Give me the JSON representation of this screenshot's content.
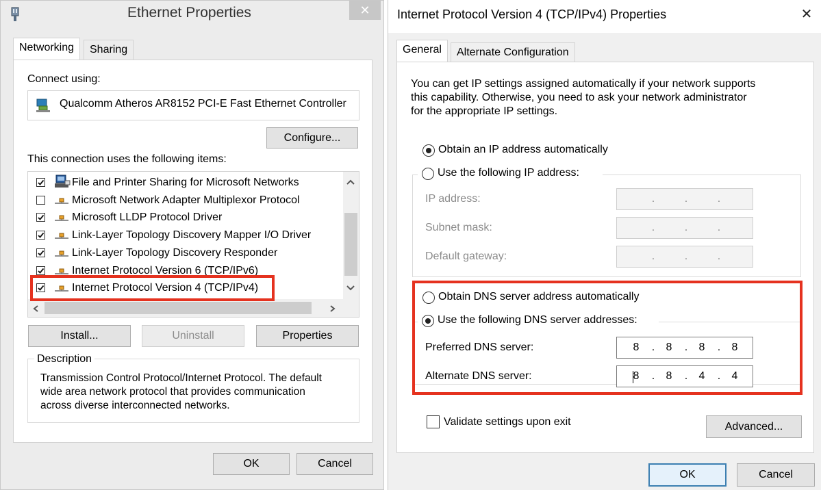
{
  "ethernet": {
    "title": "Ethernet Properties",
    "tabs": [
      "Networking",
      "Sharing"
    ],
    "connect_using_label": "Connect using:",
    "adapter_name": "Qualcomm Atheros AR8152 PCI-E Fast Ethernet Controller",
    "configure_label": "Configure...",
    "items_label": "This connection uses the following items:",
    "items": [
      {
        "label": "File and Printer Sharing for Microsoft Networks",
        "checked": true
      },
      {
        "label": "Microsoft Network Adapter Multiplexor Protocol",
        "checked": false
      },
      {
        "label": "Microsoft LLDP Protocol Driver",
        "checked": true
      },
      {
        "label": "Link-Layer Topology Discovery Mapper I/O Driver",
        "checked": true
      },
      {
        "label": "Link-Layer Topology Discovery Responder",
        "checked": true
      },
      {
        "label": "Internet Protocol Version 6 (TCP/IPv6)",
        "checked": true
      },
      {
        "label": "Internet Protocol Version 4 (TCP/IPv4)",
        "checked": true
      }
    ],
    "install_label": "Install...",
    "uninstall_label": "Uninstall",
    "properties_label": "Properties",
    "description_label": "Description",
    "description_lines": [
      "Transmission Control Protocol/Internet Protocol. The default",
      "wide area network protocol that provides communication",
      "across diverse interconnected networks."
    ],
    "ok_label": "OK",
    "cancel_label": "Cancel",
    "close_glyph": "✕"
  },
  "ipv4": {
    "title": "Internet Protocol Version 4 (TCP/IPv4) Properties",
    "close_glyph": "✕",
    "tabs": [
      "General",
      "Alternate Configuration"
    ],
    "intro_lines": [
      "You can get IP settings assigned automatically if your network supports",
      "this capability. Otherwise, you need to ask your network administrator",
      "for the appropriate IP settings."
    ],
    "obtain_ip_auto": "Obtain an IP address automatically",
    "use_following_ip": "Use the following IP address:",
    "ip_address_label": "IP address:",
    "subnet_mask_label": "Subnet mask:",
    "default_gateway_label": "Default gateway:",
    "obtain_dns_auto": "Obtain DNS server address automatically",
    "use_following_dns": "Use the following DNS server addresses:",
    "preferred_dns_label": "Preferred DNS server:",
    "alternate_dns_label": "Alternate DNS server:",
    "preferred_dns": [
      "8",
      "8",
      "8",
      "8"
    ],
    "alternate_dns": [
      "8",
      "8",
      "4",
      "4"
    ],
    "validate_label": "Validate settings upon exit",
    "advanced_label": "Advanced...",
    "ok_label": "OK",
    "cancel_label": "Cancel",
    "ip_selected": "auto",
    "dns_selected": "manual"
  },
  "highlight_color": "#e5321f"
}
